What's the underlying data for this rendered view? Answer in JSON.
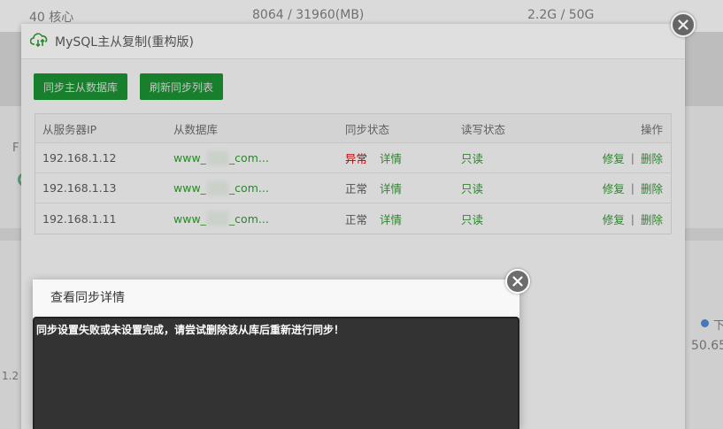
{
  "background": {
    "cpu": "40 核心",
    "memory": "8064 / 31960(MB)",
    "disk": "2.2G / 50G",
    "snippet_left": "F",
    "snippet_left2": "1.2",
    "snippet_right": "下",
    "snippet_right_value": "50.65"
  },
  "main_dialog": {
    "title": "MySQL主从复制(重构版)",
    "buttons": {
      "sync_master_slave": "同步主从数据库",
      "refresh_list": "刷新同步列表"
    },
    "table": {
      "headers": {
        "slave_ip": "从服务器IP",
        "slave_db": "从数据库",
        "sync_status": "同步状态",
        "rw_status": "读写状态",
        "actions": "操作"
      },
      "rows": [
        {
          "ip": "192.168.1.12",
          "db_prefix": "www_",
          "db_suffix": "_com...",
          "status": "异常",
          "detail": "详情",
          "rw": "只读",
          "repair": "修复",
          "delete": "删除",
          "status_kind": "error"
        },
        {
          "ip": "192.168.1.13",
          "db_prefix": "www_",
          "db_suffix": "_com...",
          "status": "正常",
          "detail": "详情",
          "rw": "只读",
          "repair": "修复",
          "delete": "删除",
          "status_kind": "ok"
        },
        {
          "ip": "192.168.1.11",
          "db_prefix": "www_",
          "db_suffix": "_com...",
          "status": "正常",
          "detail": "详情",
          "rw": "只读",
          "repair": "修复",
          "delete": "删除",
          "status_kind": "ok"
        }
      ],
      "separator": "|"
    },
    "close_icon": "close-icon"
  },
  "detail_dialog": {
    "title": "查看同步详情",
    "message": "同步设置失败或未设置完成，请尝试删除该从库后重新进行同步！",
    "close_icon": "close-icon"
  },
  "colors": {
    "accent": "#20a53a",
    "error": "#cc0000",
    "console_bg": "#333333"
  }
}
